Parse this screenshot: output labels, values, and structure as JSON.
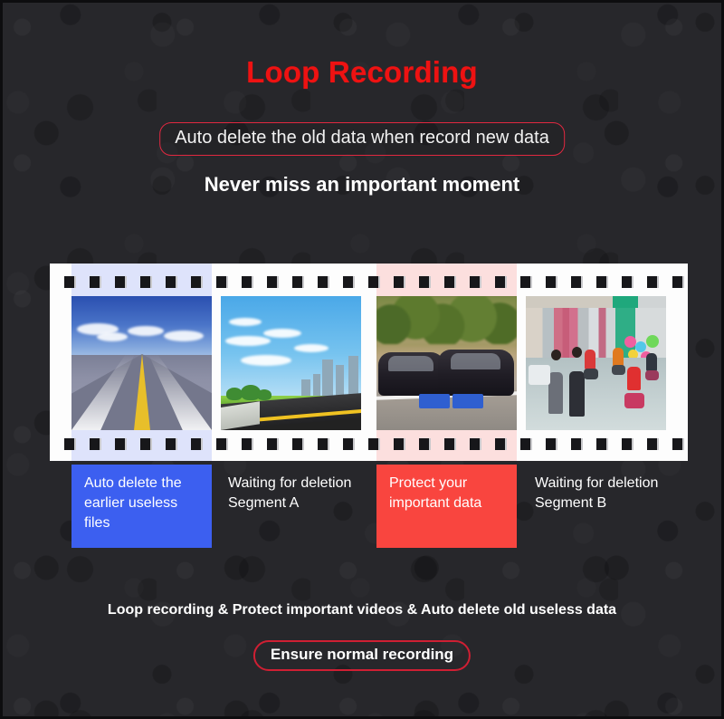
{
  "page": {
    "background_color": "#27272b",
    "accent_red": "#ee1212",
    "border_red": "#e02840",
    "blue_block": "#3c5ff0",
    "red_block": "#f9453f"
  },
  "header": {
    "title": "Loop Recording",
    "subtitle": "Auto delete the old data when record new data",
    "tagline": "Never miss an important moment"
  },
  "filmstrip": {
    "frames": [
      {
        "photo_name": "highway-over-sea-photo",
        "caption": "Auto delete the earlier useless files",
        "caption_style": "blue",
        "highlight_color": "#3c5ff0"
      },
      {
        "photo_name": "road-with-city-skyline-photo",
        "caption": "Waiting for deletion Segment A",
        "caption_style": "plain",
        "highlight_color": "none"
      },
      {
        "photo_name": "car-collision-photo",
        "caption": "Protect your important data",
        "caption_style": "red",
        "highlight_color": "#f9453f"
      },
      {
        "photo_name": "busy-street-scooters-photo",
        "caption": "Waiting for deletion Segment B",
        "caption_style": "plain",
        "highlight_color": "none"
      }
    ]
  },
  "footer": {
    "summary": "Loop recording & Protect important videos & Auto delete old useless data",
    "ensure_label": "Ensure normal recording"
  }
}
